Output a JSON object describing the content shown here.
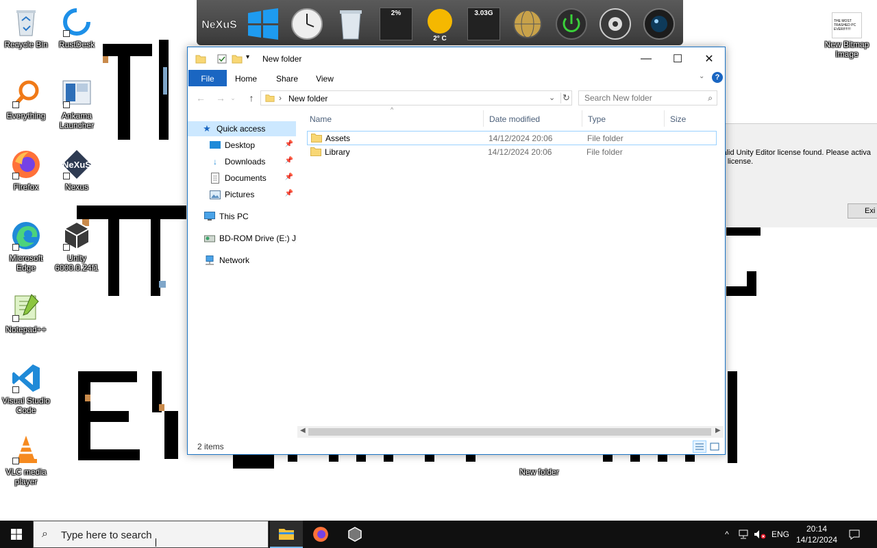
{
  "desktop": {
    "icons_left": [
      {
        "name": "recycle-bin",
        "label": "Recycle Bin"
      },
      {
        "name": "everything",
        "label": "Everything"
      },
      {
        "name": "firefox",
        "label": "Firefox"
      },
      {
        "name": "microsoft-edge",
        "label": "Microsoft Edge"
      },
      {
        "name": "notepad-plus-plus",
        "label": "Notepad++"
      },
      {
        "name": "visual-studio-code",
        "label": "Visual Studio Code"
      },
      {
        "name": "vlc",
        "label": "VLC media player"
      }
    ],
    "icons_second": [
      {
        "name": "rustdesk",
        "label": "RustDesk"
      },
      {
        "name": "ankama-launcher",
        "label": "Ankama Launcher"
      },
      {
        "name": "nexus",
        "label": "Nexus"
      },
      {
        "name": "unity",
        "label": "Unity 6000.0.24f1"
      }
    ],
    "bitmap_icon": {
      "label": "New Bitmap Image",
      "thumb_text": "THE MOST TRASHED PC EVERI!!!!!!!"
    },
    "folder_icon": {
      "label": "New folder"
    }
  },
  "dock": {
    "nexus_logo": "NeXuS",
    "cpu_meter": "2%",
    "weather_temp": "2° C",
    "ram_meter": "3.03G"
  },
  "unity_dialog": {
    "line1": "valid Unity Editor license found. Please activa",
    "line2": "ur license.",
    "exit_label": "Exi"
  },
  "explorer": {
    "title": "New folder",
    "tabs": {
      "file": "File",
      "home": "Home",
      "share": "Share",
      "view": "View"
    },
    "help": "?",
    "address": {
      "path": "New folder"
    },
    "search": {
      "placeholder": "Search New folder"
    },
    "nav": {
      "quick_access": "Quick access",
      "desktop": "Desktop",
      "downloads": "Downloads",
      "documents": "Documents",
      "pictures": "Pictures",
      "this_pc": "This PC",
      "bd_rom": "BD-ROM Drive (E:) J_C",
      "network": "Network"
    },
    "columns": {
      "name": "Name",
      "date": "Date modified",
      "type": "Type",
      "size": "Size"
    },
    "files": [
      {
        "name": "Assets",
        "date": "14/12/2024 20:06",
        "type": "File folder",
        "size": ""
      },
      {
        "name": "Library",
        "date": "14/12/2024 20:06",
        "type": "File folder",
        "size": ""
      }
    ],
    "status": "2 items"
  },
  "taskbar": {
    "search_placeholder": "Type here to search",
    "language": "ENG",
    "time": "20:14",
    "date": "14/12/2024"
  },
  "colors": {
    "accent": "#1a66c2",
    "selection": "#cce8ff",
    "taskbar": "#101010"
  }
}
